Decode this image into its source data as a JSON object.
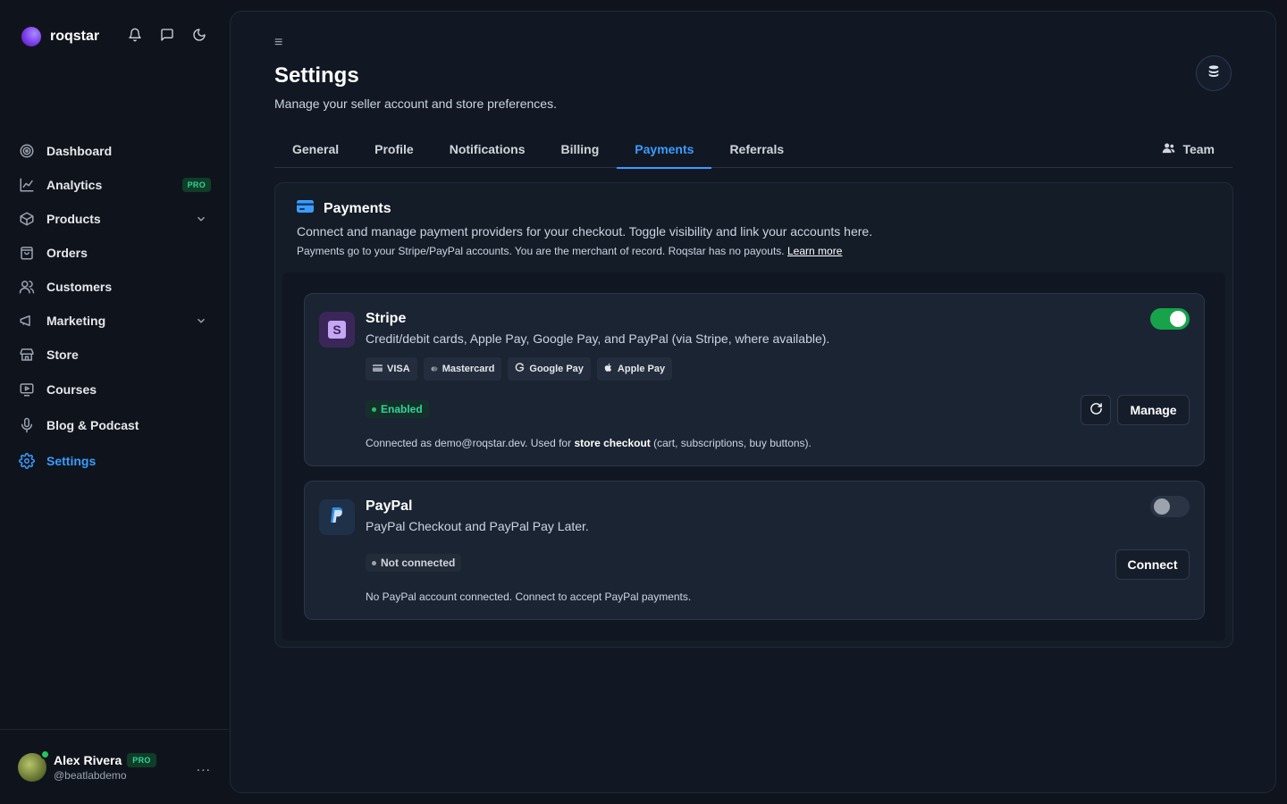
{
  "brand": {
    "name": "roqstar"
  },
  "top_icons": [
    "bell-icon",
    "message-icon",
    "moon-icon"
  ],
  "nav": [
    {
      "label": "Dashboard",
      "icon": "dashboard-icon"
    },
    {
      "label": "Analytics",
      "icon": "chart-icon",
      "badge": "PRO"
    },
    {
      "label": "Products",
      "icon": "box-icon",
      "chevron": true
    },
    {
      "label": "Orders",
      "icon": "bag-icon"
    },
    {
      "label": "Customers",
      "icon": "users-icon"
    },
    {
      "label": "Marketing",
      "icon": "megaphone-icon",
      "chevron": true
    },
    {
      "label": "Store",
      "icon": "store-icon"
    },
    {
      "label": "Courses",
      "icon": "courses-icon"
    },
    {
      "label": "Blog & Podcast",
      "icon": "mic-icon"
    },
    {
      "label": "Settings",
      "icon": "gear-icon",
      "active": true
    }
  ],
  "user": {
    "name": "Alex Rivera",
    "badge": "PRO",
    "handle": "@beatlabdemo",
    "more": "..."
  },
  "page": {
    "menu_icon": "≡",
    "title": "Settings",
    "subtitle": "Manage your seller account and store preferences."
  },
  "tabs": [
    "General",
    "Profile",
    "Notifications",
    "Billing",
    "Payments",
    "Referrals"
  ],
  "active_tab": "Payments",
  "team_label": "Team",
  "payments": {
    "title": "Payments",
    "description": "Connect and manage payment providers for your checkout. Toggle visibility and link your accounts here.",
    "note": "Payments go to your Stripe/PayPal accounts. You are the merchant of record. Roqstar has no payouts.",
    "learn_more": "Learn more"
  },
  "stripe": {
    "logo_letter": "S",
    "name": "Stripe",
    "description": "Credit/debit cards, Apple Pay, Google Pay, and PayPal (via Stripe, where available).",
    "methods": [
      "VISA",
      "Mastercard",
      "Google Pay",
      "Apple Pay"
    ],
    "enabled": true,
    "status": "Enabled",
    "footer_prefix": "Connected as demo@roqstar.dev. Used for",
    "footer_bold": "store checkout",
    "footer_suffix": "(cart, subscriptions, buy buttons).",
    "manage_label": "Manage"
  },
  "paypal": {
    "name": "PayPal",
    "description": "PayPal Checkout and PayPal Pay Later.",
    "enabled": false,
    "status": "Not connected",
    "footer": "No PayPal account connected. Connect to accept PayPal payments.",
    "connect_label": "Connect"
  },
  "colors": {
    "accent": "#3b9cff",
    "success": "#22c55e",
    "brand": "#7c3aed"
  }
}
